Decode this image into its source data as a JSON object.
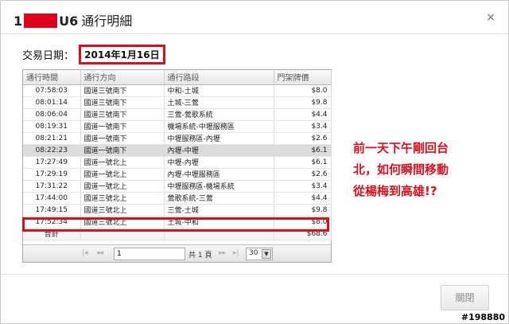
{
  "dialog": {
    "title_prefix": "1",
    "title_suffix": "U6",
    "title_text": "通行明細",
    "close_glyph": "×"
  },
  "date": {
    "label": "交易日期：",
    "value": "2014年1月16日"
  },
  "grid": {
    "columns": [
      "通行時間",
      "通行方向",
      "通行路段",
      "門架牌價"
    ],
    "rows": [
      {
        "time": "07:58:03",
        "direction": "國道三號南下",
        "segment": "中和-土城",
        "price": "$8.0"
      },
      {
        "time": "08:01:14",
        "direction": "國道三號南下",
        "segment": "土城-三鶯",
        "price": "$9.8"
      },
      {
        "time": "08:06:04",
        "direction": "國道三號南下",
        "segment": "三鶯-鶯歌系統",
        "price": "$4.4"
      },
      {
        "time": "08:19:31",
        "direction": "國道一號南下",
        "segment": "機場系統-中壢服務區",
        "price": "$3.4"
      },
      {
        "time": "08:21:21",
        "direction": "國道一號南下",
        "segment": "中壢服務區-內壢",
        "price": "$2.6"
      },
      {
        "time": "08:22:23",
        "direction": "國道一號南下",
        "segment": "內壢-中壢",
        "price": "$6.1"
      },
      {
        "time": "17:27:49",
        "direction": "國道一號北上",
        "segment": "中壢-內壢",
        "price": "$6.1"
      },
      {
        "time": "17:29:19",
        "direction": "國道一號北上",
        "segment": "內壢-中壢服務區",
        "price": "$2.6"
      },
      {
        "time": "17:31:22",
        "direction": "國道一號北上",
        "segment": "中壢服務區-機場系統",
        "price": "$3.4"
      },
      {
        "time": "17:44:00",
        "direction": "國道三號北上",
        "segment": "鶯歌系統-三鶯",
        "price": "$4.4"
      },
      {
        "time": "17:49:15",
        "direction": "國道三號北上",
        "segment": "三鶯-土城",
        "price": "$9.8"
      },
      {
        "time": "17:52:34",
        "direction": "國道三號北上",
        "segment": "土城-中和",
        "price": "$8.0"
      }
    ],
    "total_label": "合計",
    "total_value": "$68.6"
  },
  "pager": {
    "first_glyph": "|◂",
    "prev_glyph": "◂◂",
    "page_value": "1",
    "of_text": "共 1 頁",
    "next_glyph": "▸▸",
    "last_glyph": "▸|",
    "page_size": "30",
    "caret_glyph": "▼"
  },
  "note": {
    "line1": "前一天下午剛回台",
    "line2": "北，如何瞬間移動",
    "line3": "從楊梅到高雄!?"
  },
  "footer": {
    "close_label": "關閉"
  },
  "watermark": "#198880",
  "colors": {
    "highlight_red": "#d4111e",
    "redaction_red": "#e1001b",
    "selected_row": "#dcdcdc"
  }
}
